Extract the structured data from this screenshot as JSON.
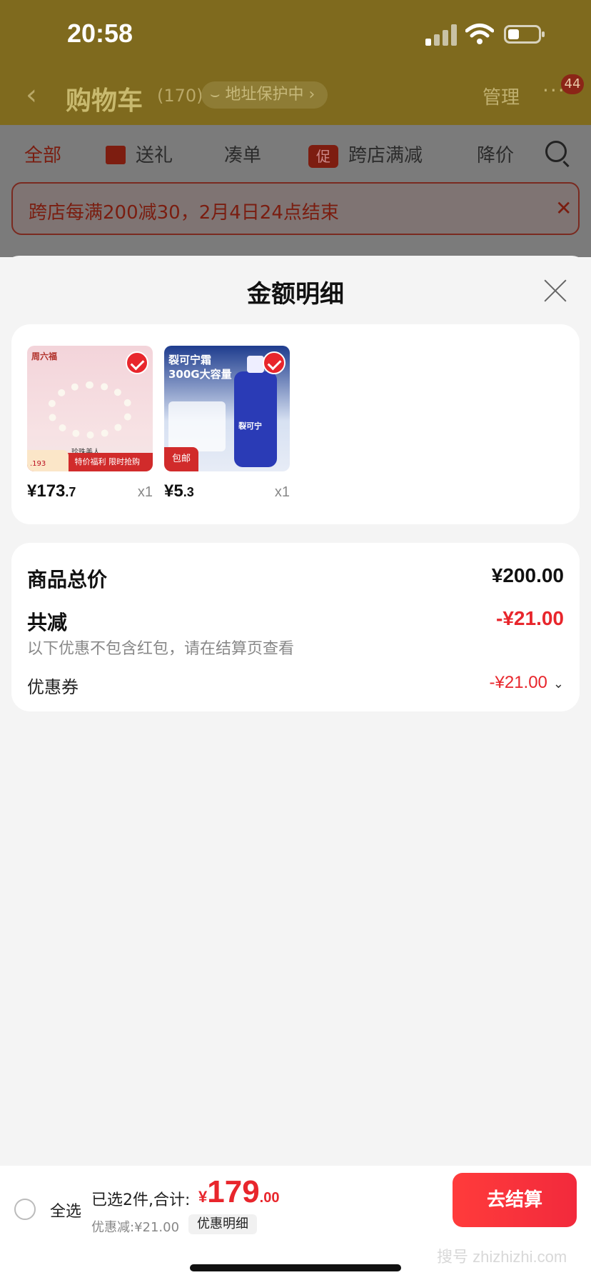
{
  "status_bar": {
    "time": "20:58"
  },
  "nav": {
    "back_glyph": "‹",
    "title": "购物车",
    "count": "(170)",
    "protect": "地址保护中",
    "manage": "管理",
    "more_glyph": "···",
    "badge": "44"
  },
  "tabs": [
    {
      "label": "全部",
      "active": true
    },
    {
      "label": "送礼",
      "icon": "gift-icon"
    },
    {
      "label": "凑单"
    },
    {
      "label": "跨店满减",
      "icon": "promo-icon",
      "icon_text": "促"
    },
    {
      "label": "降价"
    }
  ],
  "promo_banner": {
    "text": "跨店每满200减30，2月4日24点结束",
    "close_glyph": "✕"
  },
  "sheet": {
    "title": "金额明细",
    "items": [
      {
        "price_int": "¥173",
        "price_dec": ".7",
        "qty": "x1",
        "brand": "周六福",
        "caption": "珍珠美人",
        "strip": "特价福利 限时抢购",
        "tag": ".193"
      },
      {
        "price_int": "¥5",
        "price_dec": ".3",
        "qty": "x1",
        "headline": "裂可宁霜 300G大容量",
        "bottle_label": "裂可宁",
        "ship": "包邮"
      }
    ],
    "summary": {
      "total_label": "商品总价",
      "total_value": "¥200.00",
      "discount_label": "共减",
      "discount_value": "-¥21.00",
      "note": "以下优惠不包含红包，请在结算页查看",
      "coupon_label": "优惠券",
      "coupon_value": "-¥21.00",
      "coupon_chevron": "⌄"
    }
  },
  "bottom_bar": {
    "select_all": "全选",
    "selected": "已选2件,合计:",
    "currency": "¥",
    "total_int": "179",
    "total_dec": ".00",
    "discount": "优惠减:¥21.00",
    "detail_button": "优惠明细",
    "checkout_button": "去结算",
    "watermark": "搜号 zhizhizhi.com"
  },
  "colors": {
    "accent": "#e8262c",
    "nav_bg": "#7f6a1e"
  }
}
